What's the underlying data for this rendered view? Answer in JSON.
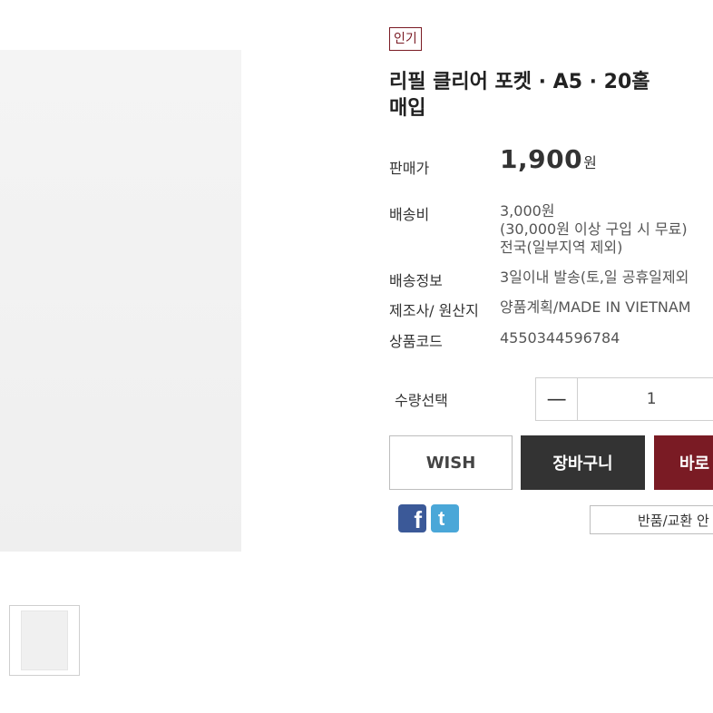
{
  "product": {
    "badge": "인기",
    "title_line1": "리필 클리어 포켓 · A5 · 20홀",
    "title_line2": "매입"
  },
  "info": {
    "price_label": "판매가",
    "price_value": "1,900",
    "price_unit": "원",
    "shipping_label": "배송비",
    "shipping_line1": "3,000원",
    "shipping_line2": "(30,000원 이상 구입 시 무료)",
    "shipping_line3": "전국(일부지역 제외)",
    "delivery_label": "배송정보",
    "delivery_value": "3일이내 발송(토,일 공휴일제외",
    "maker_label": "제조사/ 원산지",
    "maker_value": "양품계획/MADE IN VIETNAM",
    "code_label": "상품코드",
    "code_value": "4550344596784"
  },
  "quantity": {
    "label": "수량선택",
    "minus": "—",
    "value": "1"
  },
  "buttons": {
    "wish": "WISH",
    "cart": "장바구니",
    "buy": "바로",
    "exchange": "반품/교환 안"
  },
  "social": {
    "facebook_glyph": "f",
    "twitter_glyph": "t",
    "facebook_icon": "facebook-icon",
    "twitter_icon": "twitter-icon"
  },
  "colors": {
    "accent": "#7a1b24",
    "cart_button": "#333333",
    "facebook": "#3b5998",
    "twitter": "#4aa7d8"
  }
}
